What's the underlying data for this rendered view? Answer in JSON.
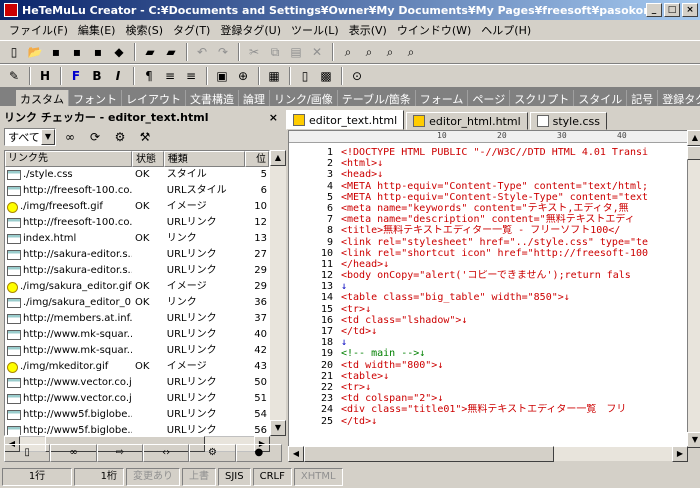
{
  "window": {
    "title": "HeTeMuLu Creator - C:¥Documents and Settings¥Owner¥My Documents¥My Pages¥freesoft¥pasokon¥editor_tex..."
  },
  "menu": [
    "ファイル(F)",
    "編集(E)",
    "検索(S)",
    "タグ(T)",
    "登録タグ(U)",
    "ツール(L)",
    "表示(V)",
    "ウインドウ(W)",
    "ヘルプ(H)"
  ],
  "tabs": [
    "カスタム",
    "フォント",
    "レイアウト",
    "文書構造",
    "論理",
    "リンク/画像",
    "テーブル/箇条",
    "フォーム",
    "ページ",
    "スクリプト",
    "スタイル",
    "記号",
    "登録タグ"
  ],
  "link_checker": {
    "title": "リンク チェッカー - editor_text.html",
    "filter": "すべて",
    "headers": [
      "リンク先",
      "状態",
      "種類",
      "位"
    ],
    "rows": [
      {
        "icon": "file",
        "link": "./style.css",
        "status": "OK",
        "type": "スタイル",
        "pos": "5"
      },
      {
        "icon": "file",
        "link": "http://freesoft-100.co...",
        "status": "",
        "type": "URLスタイル",
        "pos": "6"
      },
      {
        "icon": "img",
        "link": "./img/freesoft.gif",
        "status": "OK",
        "type": "イメージ",
        "pos": "10"
      },
      {
        "icon": "file",
        "link": "http://freesoft-100.co...",
        "status": "",
        "type": "URLリンク",
        "pos": "12"
      },
      {
        "icon": "file",
        "link": "index.html",
        "status": "OK",
        "type": "リンク",
        "pos": "13"
      },
      {
        "icon": "file",
        "link": "http://sakura-editor.s...",
        "status": "",
        "type": "URLリンク",
        "pos": "27"
      },
      {
        "icon": "file",
        "link": "http://sakura-editor.s...",
        "status": "",
        "type": "URLリンク",
        "pos": "29"
      },
      {
        "icon": "img",
        "link": "./img/sakura_editor.gif",
        "status": "OK",
        "type": "イメージ",
        "pos": "29"
      },
      {
        "icon": "file",
        "link": "./img/sakura_editor_0...",
        "status": "OK",
        "type": "リンク",
        "pos": "36"
      },
      {
        "icon": "file",
        "link": "http://members.at.inf...",
        "status": "",
        "type": "URLリンク",
        "pos": "37"
      },
      {
        "icon": "file",
        "link": "http://www.mk-squar...",
        "status": "",
        "type": "URLリンク",
        "pos": "40"
      },
      {
        "icon": "file",
        "link": "http://www.mk-squar...",
        "status": "",
        "type": "URLリンク",
        "pos": "42"
      },
      {
        "icon": "img",
        "link": "./img/mkeditor.gif",
        "status": "OK",
        "type": "イメージ",
        "pos": "43"
      },
      {
        "icon": "file",
        "link": "http://www.vector.co.j...",
        "status": "",
        "type": "URLリンク",
        "pos": "50"
      },
      {
        "icon": "file",
        "link": "http://www.vector.co.j...",
        "status": "",
        "type": "URLリンク",
        "pos": "51"
      },
      {
        "icon": "file",
        "link": "http://www5f.biglobe....",
        "status": "",
        "type": "URLリンク",
        "pos": "54"
      },
      {
        "icon": "file",
        "link": "http://www5f.biglobe....",
        "status": "",
        "type": "URLリンク",
        "pos": "56"
      }
    ]
  },
  "editor_tabs": [
    "editor_text.html",
    "editor_html.html",
    "style.css"
  ],
  "editor_lines": [
    {
      "n": "1",
      "t": "<!DOCTYPE HTML PUBLIC \"-//W3C//DTD HTML 4.01 Transi"
    },
    {
      "n": "2",
      "t": "<html>↓"
    },
    {
      "n": "3",
      "t": "<head>↓"
    },
    {
      "n": "4",
      "t": "<META http-equiv=\"Content-Type\" content=\"text/html;"
    },
    {
      "n": "5",
      "t": "<META http-equiv=\"Content-Style-Type\" content=\"text"
    },
    {
      "n": "6",
      "t": "<meta name=\"keywords\" content=\"テキスト,エディタ,無"
    },
    {
      "n": "7",
      "t": "<meta name=\"description\" content=\"無料テキストエディ"
    },
    {
      "n": "8",
      "t": "<title>無料テキストエディター一覧 - フリーソフト100</"
    },
    {
      "n": "9",
      "t": "<link rel=\"stylesheet\" href=\"../style.css\" type=\"te"
    },
    {
      "n": "10",
      "t": "<link rel=\"shortcut icon\" href=\"http://freesoft-100"
    },
    {
      "n": "11",
      "t": "</head>↓"
    },
    {
      "n": "12",
      "t": "<body onCopy=\"alert('コピーできません');return fals"
    },
    {
      "n": "13",
      "t": "↓"
    },
    {
      "n": "14",
      "t": "<table class=\"big_table\" width=\"850\">↓"
    },
    {
      "n": "15",
      "t": "<tr>↓"
    },
    {
      "n": "16",
      "t": "<td class=\"lshadow\">↓"
    },
    {
      "n": "17",
      "t": "</td>↓"
    },
    {
      "n": "18",
      "t": "↓"
    },
    {
      "n": "19",
      "t": "<!-- main -->↓"
    },
    {
      "n": "20",
      "t": "<td width=\"800\">↓"
    },
    {
      "n": "21",
      "t": "<table>↓"
    },
    {
      "n": "22",
      "t": "<tr>↓"
    },
    {
      "n": "23",
      "t": "<td colspan=\"2\">↓"
    },
    {
      "n": "24",
      "t": "<div class=\"title01\">無料テキストエディター一覧　フリ"
    },
    {
      "n": "25",
      "t": "</td>↓"
    }
  ],
  "status": [
    "1行",
    "1桁",
    "変更あり",
    "上書",
    "SJIS",
    "CRLF",
    "XHTML"
  ]
}
